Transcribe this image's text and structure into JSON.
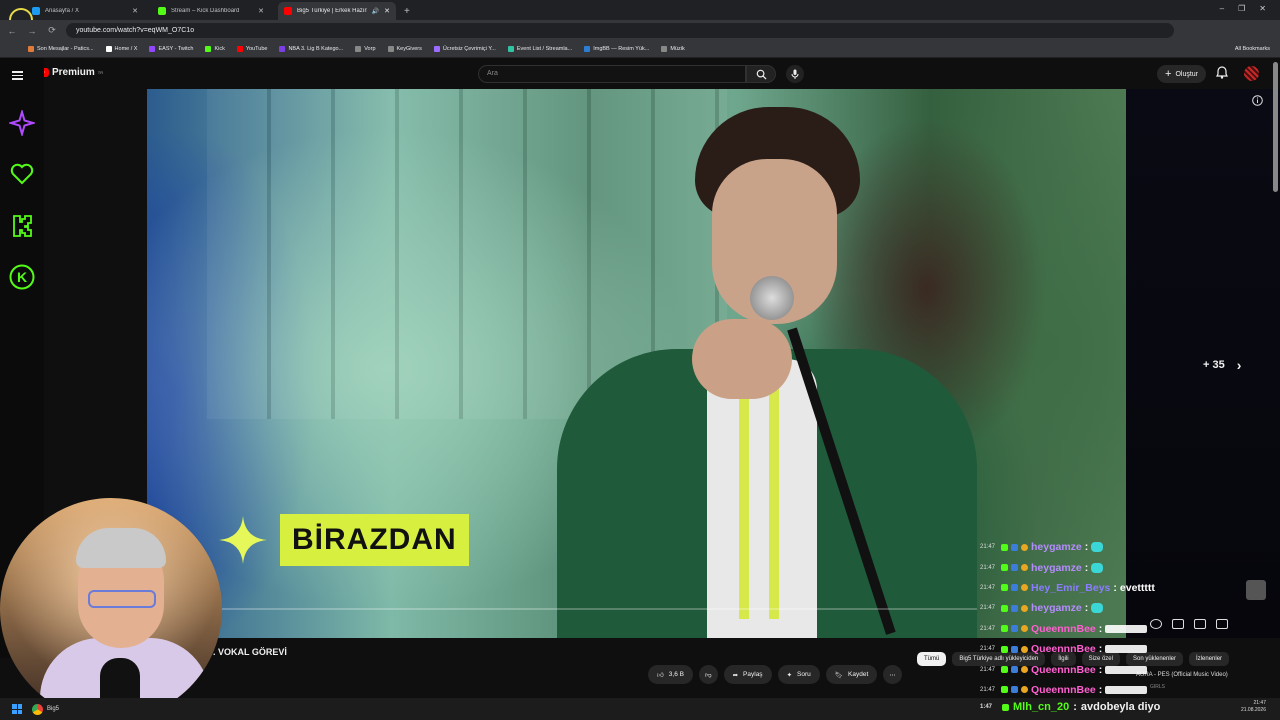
{
  "browser": {
    "tabs": [
      {
        "label": "Anasayfa / X",
        "color": "#1d9bf0",
        "active": false
      },
      {
        "label": "Stream – Kick Dashboard",
        "color": "#53fc18",
        "active": false
      },
      {
        "label": "Big5 Türkiye | Erkek Hazırlı",
        "color": "#ff0000",
        "active": true
      }
    ],
    "url": "youtube.com/watch?v=eqWM_O7C1o",
    "bookmarks": [
      {
        "label": "Son Mesajlar - Patics...",
        "color": "#e07b39"
      },
      {
        "label": "Home / X",
        "color": "#ffffff"
      },
      {
        "label": "EASY - Twitch",
        "color": "#9146ff"
      },
      {
        "label": "Kick",
        "color": "#53fc18"
      },
      {
        "label": "YouTube",
        "color": "#ff0000"
      },
      {
        "label": "NBA 3. Lig B Katego...",
        "color": "#7b3fe4"
      },
      {
        "label": "Vorp",
        "color": "#888888"
      },
      {
        "label": "KeyGivers",
        "color": "#888888"
      },
      {
        "label": "Ücretsiz Çevrimiçi Y...",
        "color": "#9c6bff"
      },
      {
        "label": "Event List / Streamla...",
        "color": "#31c3a2"
      },
      {
        "label": "ImgBB — Resim Yük...",
        "color": "#2d7dd2"
      },
      {
        "label": "Müzik",
        "color": "#888888"
      }
    ],
    "all_bookmarks": "All Bookmarks"
  },
  "youtube": {
    "logo_text": "Premium",
    "logo_sup": "TR",
    "search_placeholder": "Ara",
    "create_label": "Oluştur",
    "skip_label": "+ 35",
    "overlay_text": "BİRAZDAN",
    "video_title": ". VOKAL GÖREVİ",
    "like_count": "3,6 B",
    "share_label": "Paylaş",
    "ask_label": "Soru",
    "save_label": "Kaydet",
    "chips": [
      {
        "label": "Tümü",
        "selected": true
      },
      {
        "label": "Big5 Türkiye adlı yükleyiciden",
        "selected": false
      },
      {
        "label": "İlgili",
        "selected": false
      },
      {
        "label": "Size özel",
        "selected": false
      },
      {
        "label": "Son yüklenenler",
        "selected": false
      },
      {
        "label": "İzlenenler",
        "selected": false
      }
    ],
    "mini_title": "AURA - PES (Official Music Video)",
    "mini_sub": "GIRLS"
  },
  "chat": {
    "messages": [
      {
        "time": "21:47",
        "user": "heygamze",
        "color": "#b58cff",
        "msg": ""
      },
      {
        "time": "21:47",
        "user": "heygamze",
        "color": "#b58cff",
        "msg": ""
      },
      {
        "time": "21:47",
        "user": "Hey_Emir_Beys",
        "color": "#8a7dff",
        "msg": "evettttt"
      },
      {
        "time": "21:47",
        "user": "heygamze",
        "color": "#b58cff",
        "msg": ""
      },
      {
        "time": "21:47",
        "user": "QueennnBee",
        "color": "#ff5fd0",
        "msg": ""
      },
      {
        "time": "21:47",
        "user": "QueennnBee",
        "color": "#ff5fd0",
        "msg": ""
      },
      {
        "time": "21:47",
        "user": "QueennnBee",
        "color": "#ff5fd0",
        "msg": ""
      },
      {
        "time": "21:47",
        "user": "QueennnBee",
        "color": "#ff5fd0",
        "msg": ""
      }
    ],
    "bottom": {
      "time": "1:47",
      "user": "Mlh_cn_20",
      "color": "#53fc18",
      "msg": "avdobeyla diyo"
    }
  },
  "taskbar": {
    "chrome_label": "Big5",
    "clock": "21:47",
    "date": "21.08.2026"
  }
}
